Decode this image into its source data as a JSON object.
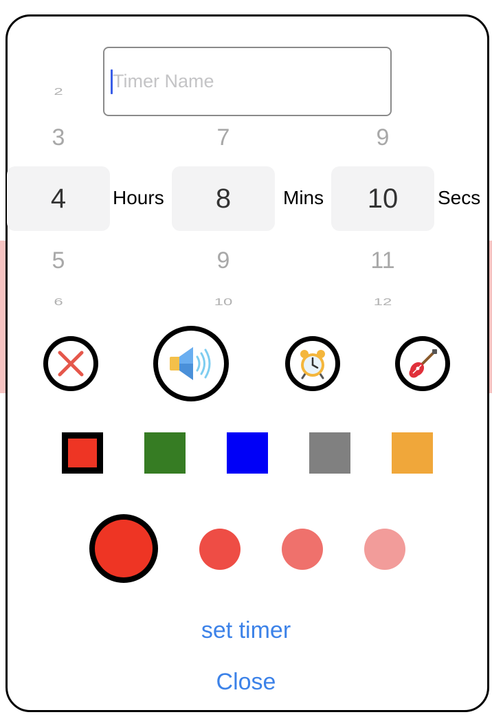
{
  "timer_name": {
    "value": "",
    "placeholder": "Timer Name"
  },
  "hours": {
    "far_above": "2",
    "above": "3",
    "selected": "4",
    "below": "5",
    "far_below": "6",
    "unit": "Hours"
  },
  "mins": {
    "above": "7",
    "selected": "8",
    "below": "9",
    "far_below": "10",
    "unit": "Mins"
  },
  "secs": {
    "above": "9",
    "selected": "10",
    "below": "11",
    "far_below": "12",
    "unit": "Secs"
  },
  "sounds": [
    {
      "icon": "no-sound-icon",
      "selected": false
    },
    {
      "icon": "speaker-icon",
      "selected": true
    },
    {
      "icon": "alarm-clock-icon",
      "selected": false
    },
    {
      "icon": "guitar-icon",
      "selected": false
    }
  ],
  "colors": [
    {
      "hex": "#ee3524",
      "selected": true
    },
    {
      "hex": "#367c23",
      "selected": false
    },
    {
      "hex": "#0000f7",
      "selected": false
    },
    {
      "hex": "#808080",
      "selected": false
    },
    {
      "hex": "#f0a73a",
      "selected": false
    }
  ],
  "shades": [
    {
      "hex": "#ee3524",
      "selected": true
    },
    {
      "hex": "#ee4d45",
      "selected": false
    },
    {
      "hex": "#ef716c",
      "selected": false
    },
    {
      "hex": "#f29c9a",
      "selected": false
    }
  ],
  "actions": {
    "set_timer": "set timer",
    "close": "Close"
  },
  "accent": "#3c82e8"
}
